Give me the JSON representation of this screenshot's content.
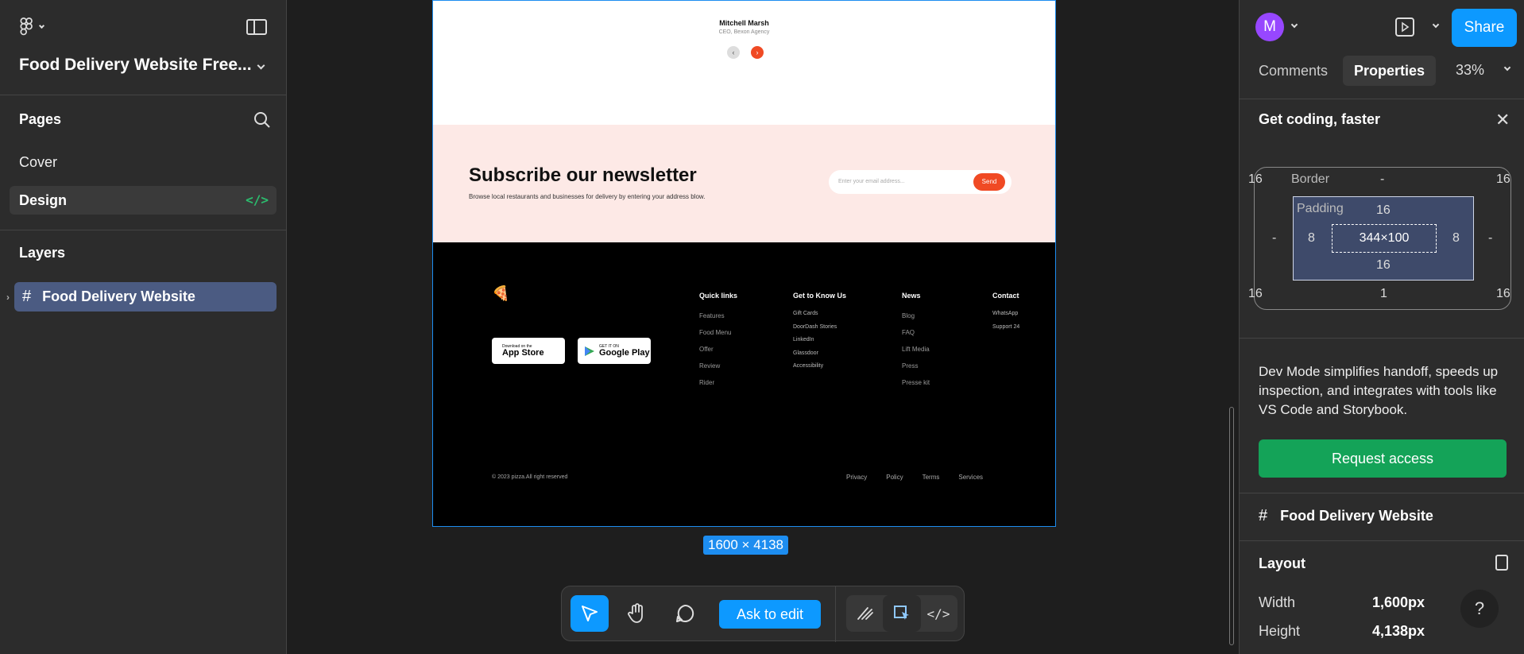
{
  "left_panel": {
    "file_title": "Food Delivery Website Free...",
    "pages_label": "Pages",
    "pages": [
      "Cover",
      "Design"
    ],
    "layers_label": "Layers",
    "layers": [
      "Food Delivery Website"
    ]
  },
  "canvas": {
    "testimonial": {
      "name": "Mitchell Marsh",
      "role": "CEO, Bexon Agency"
    },
    "newsletter": {
      "title": "Subscribe our newsletter",
      "subtitle": "Browse local restaurants and businesses for delivery by entering your address blow.",
      "placeholder": "Enter your email address...",
      "button": "Send"
    },
    "footer": {
      "app_store_small": "Download on the",
      "app_store_big": "App Store",
      "google_small": "GET IT ON",
      "google_big": "Google Play",
      "columns": [
        {
          "title": "Quick links",
          "items": [
            "Features",
            "Food Menu",
            "Offer",
            "Review",
            "Rider"
          ]
        },
        {
          "title": "Get to Know Us",
          "items": [
            "Gift Cards",
            "DoorDash Stories",
            "LinkedIn",
            "Glassdoor",
            "Accessibility"
          ]
        },
        {
          "title": "News",
          "items": [
            "Blog",
            "FAQ",
            "Lift Media",
            "Press",
            "Presse kit"
          ]
        },
        {
          "title": "Contact",
          "items": [
            "WhatsApp",
            "Support 24"
          ]
        }
      ],
      "copyright": "© 2023 pizza.All right reserved",
      "bottom_links": [
        "Privacy",
        "Policy",
        "Terms",
        "Services"
      ]
    },
    "dimension_label": "1600 × 4138"
  },
  "toolbar": {
    "ask_to_edit": "Ask to edit"
  },
  "right_panel": {
    "avatar_initial": "M",
    "share": "Share",
    "tabs": [
      "Comments",
      "Properties"
    ],
    "zoom": "33%",
    "banner_title": "Get coding, faster",
    "box_model": {
      "border_label": "Border",
      "padding_label": "Padding",
      "outer_top_left": "16",
      "outer_top_right": "16",
      "outer_bottom_left": "16",
      "outer_bottom_right": "16",
      "border_top": "-",
      "border_left": "-",
      "border_right": "-",
      "border_bottom": "1",
      "padding_top": "16",
      "padding_left": "8",
      "padding_right": "8",
      "padding_bottom": "16",
      "content_size": "344×100"
    },
    "dev_mode_text": "Dev Mode simplifies handoff, speeds up inspection, and integrates with tools like VS Code and Storybook.",
    "request_access": "Request access",
    "frame_name": "Food Delivery Website",
    "layout_title": "Layout",
    "width_label": "Width",
    "width_value": "1,600px",
    "height_label": "Height",
    "height_value": "4,138px"
  }
}
